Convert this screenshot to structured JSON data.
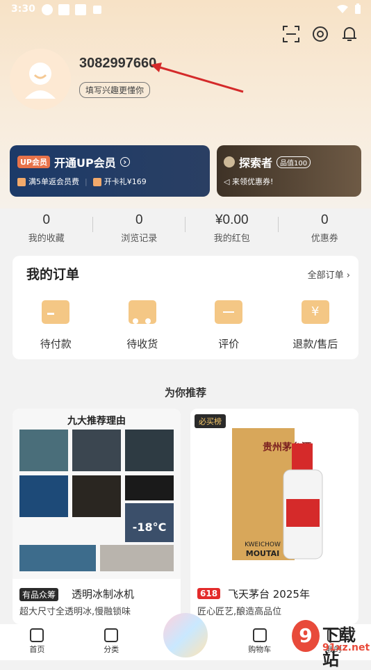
{
  "status_bar": {
    "time": "3:30"
  },
  "user": {
    "id": "3082997660",
    "tagline": "填写兴趣更懂你"
  },
  "vip": {
    "badge": "UP会员",
    "title": "开通UP会员",
    "perk1": "满5单返会员费",
    "perk2": "开卡礼¥169"
  },
  "explorer": {
    "title": "探索者",
    "badge": "品值100",
    "subtitle": "来领优惠券!"
  },
  "stats": [
    {
      "value": "0",
      "label": "我的收藏"
    },
    {
      "value": "0",
      "label": "浏览记录"
    },
    {
      "value": "¥0.00",
      "label": "我的红包"
    },
    {
      "value": "0",
      "label": "优惠券"
    }
  ],
  "orders": {
    "title": "我的订单",
    "all_label": "全部订单",
    "items": [
      {
        "label": "待付款",
        "icon": "wallet-icon"
      },
      {
        "label": "待收货",
        "icon": "truck-icon"
      },
      {
        "label": "评价",
        "icon": "comment-icon"
      },
      {
        "label": "退款/售后",
        "icon": "refund-icon"
      }
    ]
  },
  "recommend": {
    "heading": "为你推荐",
    "products": [
      {
        "tag": "有品众筹",
        "title": "透明冰制冰机",
        "desc": "超大尺寸全透明冰,慢融锁味",
        "image_title": "九大推荐理由",
        "image_temp": "-18°C"
      },
      {
        "tag": "618",
        "title": "飞天茅台 2025年",
        "desc": "匠心匠艺,酿造高品位",
        "badge": "必买榜",
        "bottle_text1": "贵州茅台酒",
        "bottle_text2": "KWEICHOW",
        "bottle_text3": "MOUTAI"
      }
    ]
  },
  "nav": {
    "items": [
      "首页",
      "分类",
      "",
      "购物车",
      "我的"
    ]
  },
  "watermark": {
    "text1": "下载站",
    "text2": "91xz.net"
  },
  "colors": {
    "accent": "#e8734a",
    "vip_bg": "#1c3a68",
    "icon_gold": "#f4c785",
    "red_tag": "#e32b2b"
  }
}
